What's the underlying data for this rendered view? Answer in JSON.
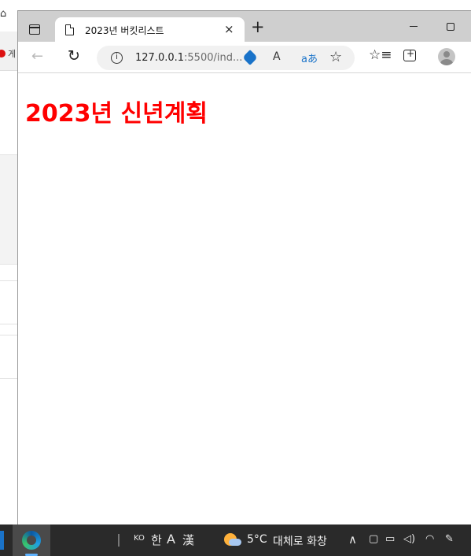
{
  "window": {
    "tab_title": "2023년 버킷리스트",
    "tab_close": "×",
    "new_tab": "+"
  },
  "toolbar": {
    "back_icon": "←",
    "refresh_icon": "↻",
    "info_icon": "i",
    "url_host": "127.0.0.1",
    "url_rest": ":5500/ind...",
    "read_aloud": "A",
    "translate": "aあ",
    "add_favorite": "☆",
    "favorites": "☆≡"
  },
  "page": {
    "heading": "2023년 신년계획",
    "heading_color": "#ff0000"
  },
  "background": {
    "partial_text": "게"
  },
  "taskbar": {
    "ime_mode": "KO",
    "hangul_key": "한",
    "alpha_key": "A",
    "hanja_key": "漢",
    "temperature": "5°C",
    "weather": "대체로 화창",
    "tray_chevron": "∧"
  }
}
